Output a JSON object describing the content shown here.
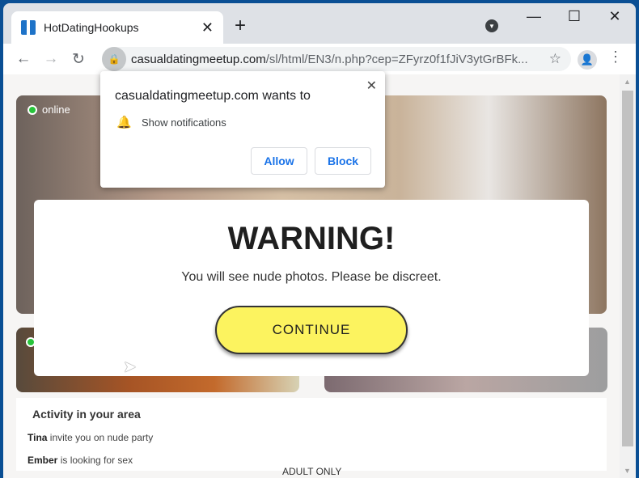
{
  "browser": {
    "tab_title": "HotDatingHookups",
    "tab_close": "✕",
    "new_tab": "+",
    "controls": {
      "minimize": "—",
      "maximize": "☐",
      "close": "✕"
    },
    "nav": {
      "back": "←",
      "forward": "→",
      "reload": "↻"
    },
    "url_domain": "casualdatingmeetup.com",
    "url_path": "/sl/html/EN3/n.php?cep=ZFyrz0f1fJiV3ytGrBFk...",
    "star": "☆",
    "menu": "⋮"
  },
  "notification_popup": {
    "title": "casualdatingmeetup.com wants to",
    "permission": "Show notifications",
    "allow_label": "Allow",
    "block_label": "Block",
    "close": "✕"
  },
  "page": {
    "online_label": "online",
    "warning": {
      "title": "WARNING!",
      "message": "You will see nude photos. Please be discreet.",
      "button_label": "CONTINUE"
    },
    "activity": {
      "heading": "Activity in your area",
      "items": [
        {
          "name": "Tina",
          "text": " invite you on nude party"
        },
        {
          "name": "Ember",
          "text": " is looking for sex"
        }
      ]
    },
    "footer": "ADULT ONLY"
  },
  "colors": {
    "continue_button": "#fcf35f",
    "online_dot": "#27c43a",
    "link_blue": "#1a73e8"
  }
}
